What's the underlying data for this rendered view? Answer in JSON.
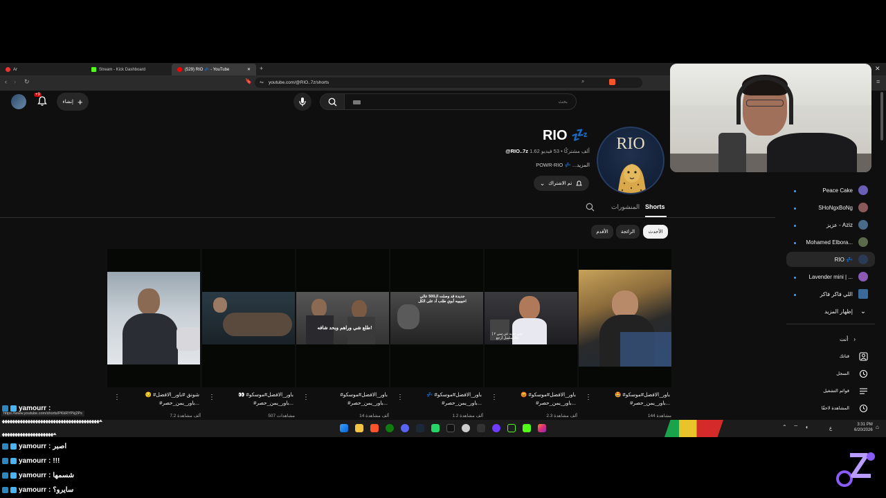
{
  "browser": {
    "tabs": [
      {
        "label": "Ar"
      },
      {
        "label": "Stream - Kick Dashboard"
      },
      {
        "label": "(529) RIO 💤 - YouTube"
      }
    ],
    "url": "youtube.com/@RIO..7z/shorts",
    "close_glyph": "✕",
    "new_tab_glyph": "+",
    "status_url": "https://www.youtube.com/shorts/PKkRYPkj2Ps"
  },
  "header": {
    "search_placeholder": "بحث",
    "create_label": "إنشاء",
    "notification_count": "+9"
  },
  "channel": {
    "name": "RIO 💤",
    "avatar_text": "RIO",
    "handle": "@RIO..7z",
    "stats": "1.62 ألف مشتركًا • 53 فيديو",
    "description": "POWR-RIO 💤 ...المزيد",
    "subscribe_label": "تم الاشتراك",
    "tabs": {
      "shorts": "Shorts",
      "posts": "المنشورات"
    },
    "chips": [
      "الأحدث",
      "الرائجة",
      "الأقدم"
    ]
  },
  "shorts": [
    {
      "caption1": "🤩 #باور_الافضل#موسكو",
      "caption2": "#باور_يمن_حصر...",
      "views": "144 مشاهدة"
    },
    {
      "caption1": "😡 #باور_الافضل#موسكو",
      "caption2": "#باور_يمن_حصر...",
      "views": "2.3 ألف مشاهدة"
    },
    {
      "caption1": "💤 #باور_الافضل#موسكو",
      "caption2": "#باور_يمن_حصر...",
      "views": "1.2 ألف مشاهدة"
    },
    {
      "caption1": "#باور_الافضل#موسكو",
      "caption2": "#باور_يمن_حصر...",
      "views": "14 ألف مشاهدة"
    },
    {
      "caption1": "👀 #باور_الافضل#موسكو",
      "caption2": "#باور_يمن_حصر...",
      "views": "507 مشاهدات"
    },
    {
      "caption1": "😏 #شونق #باور_الافضل",
      "caption2": "#باور_يمن_حصر...",
      "views": "7.2 ألف مشاهدة"
    }
  ],
  "thumb_text": {
    "short3": "طلع شي وراهم وبحد شافه!",
    "short4": "جديدة قد وصلت الـ500 عالي احبيبيبه أبوي طلب أد على الكل",
    "short5": "شي جديد عن سي ٢ | عالتسلسل أرجع"
  },
  "sidebar": {
    "subscriptions": [
      {
        "label": "Peace Cake",
        "color": "#6b5fb5"
      },
      {
        "label": "SHoNgxBoNg",
        "color": "#8a5a5a"
      },
      {
        "label": "عزيز - Aziz",
        "color": "#4a6a8a"
      },
      {
        "label": "Mohamed Elbora...",
        "color": "#5a6a4a"
      },
      {
        "label": "RIO 💤",
        "color": "#2b3a55"
      },
      {
        "label": "Lavender mini | ...",
        "color": "#8a5ab5"
      },
      {
        "label": "اللي فاكر فاكر",
        "color": "#3a6a9a"
      }
    ],
    "show_more": "إظهار المزيد",
    "you_title": "أنت",
    "library": [
      {
        "label": "قناتك",
        "icon": "user-icon"
      },
      {
        "label": "السجل",
        "icon": "history-icon"
      },
      {
        "label": "قوائم التشغيل",
        "icon": "playlist-icon"
      },
      {
        "label": "المشاهدة لاحقًا",
        "icon": "clock-icon"
      }
    ]
  },
  "taskbar": {
    "time": "3:31 PM",
    "date": "6/20/2026",
    "lang": "ع"
  },
  "chat": [
    {
      "user": "yamourr",
      "message": ""
    },
    {
      "user": "",
      "message": "ﻪﻬﻬﻬﻬﻬﻬﻬﻬﻬﻬﻬﻬﻬﻬﻬﻬﻬﻬﻬﻬﻬﻬﻬﻬﻬﻬﻬﻬﻬﻬﻬﻬﻬﻬﻬﻬﻬﻬ"
    },
    {
      "user": "",
      "message": "ﻪﻬﻬﻬﻬﻬﻬﻬﻬﻬﻬﻬﻬﻬﻬﻬﻬﻬﻬﻬﻬ"
    },
    {
      "user": "yamourr",
      "message": "اصبر"
    },
    {
      "user": "yamourr",
      "message": "!!!"
    },
    {
      "user": "yamourr",
      "message": "شسمها"
    },
    {
      "user": "yamourr",
      "message": "سايرو؟"
    }
  ],
  "colors": {
    "accent": "#ff0000",
    "kick": "#53fc18",
    "background": "#0f0f0f"
  }
}
